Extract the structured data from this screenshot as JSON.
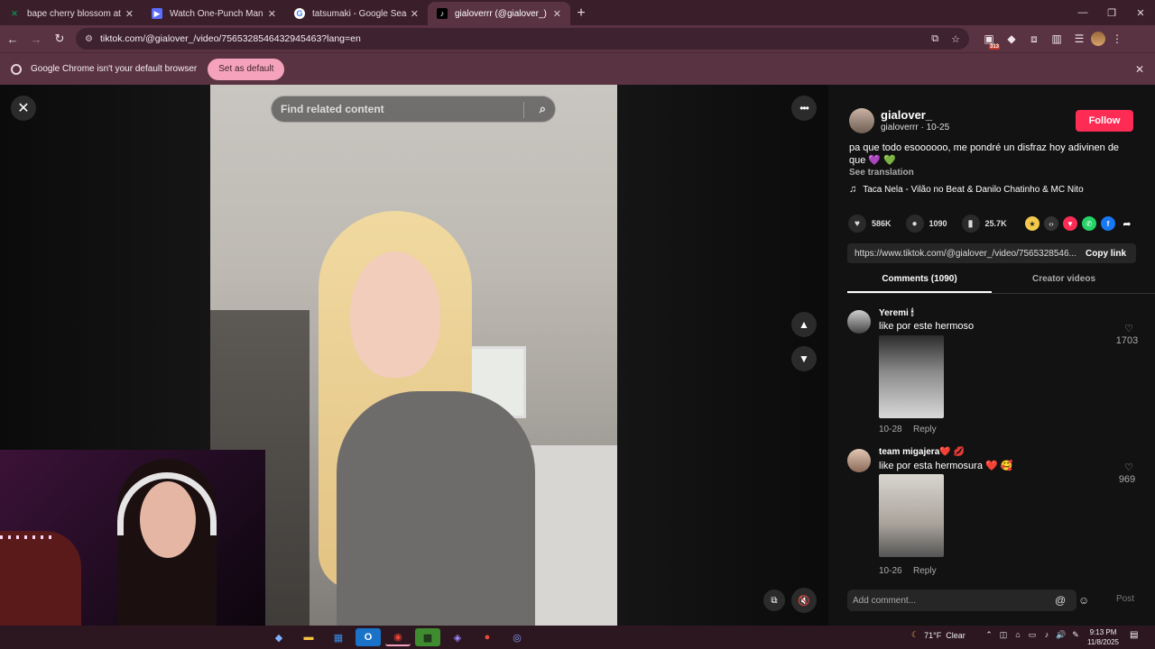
{
  "browser": {
    "tabs": [
      {
        "title": "bape cherry blossom at StockX",
        "favicon": "stockx-icon",
        "fav_color": "#0e8a4f"
      },
      {
        "title": "Watch One-Punch Man full HD",
        "favicon": "video-icon",
        "fav_color": "#5b6cff"
      },
      {
        "title": "tatsumaki - Google Search",
        "favicon": "google-icon",
        "fav_color": "#ffffff"
      },
      {
        "title": "gialoverrr (@gialover_) | TikTok",
        "favicon": "tiktok-icon",
        "fav_color": "#000000"
      }
    ],
    "url": "tiktok.com/@gialover_/video/7565328546432945463?lang=en",
    "extension_badge": "313",
    "infobar_text": "Google Chrome isn't your default browser",
    "infobar_button": "Set as default"
  },
  "video": {
    "search_placeholder": "Find related content"
  },
  "post": {
    "author_name": "gialover_",
    "author_meta": "gialoverrr · 10-25",
    "follow_label": "Follow",
    "caption": "pa que todo esoooooo, me pondré un disfraz hoy adivinen de que 💜 💚",
    "see_translation": "See translation",
    "music": "Taca Nela - Vilão no Beat & Danilo Chatinho & MC Nito",
    "likes": "586K",
    "comments": "1090",
    "saves": "25.7K",
    "link": "https://www.tiktok.com/@gialover_/video/7565328546...",
    "copy_link": "Copy link",
    "tab_comments": "Comments (1090)",
    "tab_creator": "Creator videos"
  },
  "comments": [
    {
      "user": "Yeremi 🕯",
      "text": "like por este hermoso",
      "date": "10-28",
      "reply": "Reply",
      "likes": "1703"
    },
    {
      "user": "team migajera❤️ 💋",
      "text": "like por esta hermosura ❤️ 🥰",
      "date": "10-26",
      "reply": "Reply",
      "likes": "969"
    }
  ],
  "composer": {
    "placeholder": "Add comment...",
    "post": "Post"
  },
  "taskbar": {
    "weather_temp": "71°F",
    "weather_desc": "Clear",
    "time": "9:13 PM",
    "date": "11/8/2025"
  },
  "colors": {
    "follow": "#fe2c55",
    "chrome_frame": "#5a3342",
    "set_default": "#f5a3bc"
  }
}
